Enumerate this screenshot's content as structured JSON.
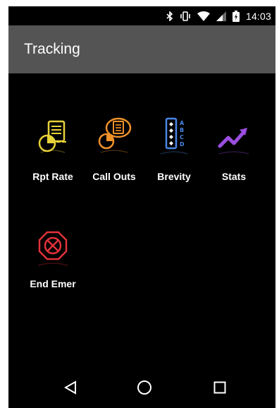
{
  "status_bar": {
    "time": "14:03",
    "icons": [
      "bluetooth-icon",
      "vibrate-icon",
      "wifi-icon",
      "signal-icon",
      "battery-icon"
    ]
  },
  "app_bar": {
    "title": "Tracking"
  },
  "tiles": [
    {
      "label": "Rpt Rate",
      "icon": "report-rate-icon",
      "color": "#e8d23a"
    },
    {
      "label": "Call Outs",
      "icon": "call-outs-icon",
      "color": "#f0922a"
    },
    {
      "label": "Brevity",
      "icon": "brevity-icon",
      "color": "#4a86e8",
      "letters": [
        "A",
        "B",
        "C",
        "D"
      ]
    },
    {
      "label": "Stats",
      "icon": "stats-icon",
      "color": "#9b4ee0"
    },
    {
      "label": "End Emer",
      "icon": "end-emergency-icon",
      "color": "#e0323a"
    }
  ],
  "nav_bar": {
    "buttons": [
      "back-icon",
      "home-icon",
      "recents-icon"
    ]
  }
}
